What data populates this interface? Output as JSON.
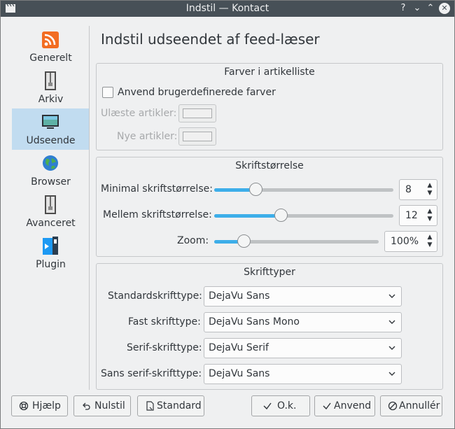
{
  "window": {
    "title": "Indstil — Kontact",
    "help_glyph": "?",
    "minimize_glyph": "⌄",
    "maximize_glyph": "⌃",
    "close_glyph": "✕"
  },
  "sidebar": {
    "items": [
      {
        "label": "Generelt",
        "icon": "rss-icon"
      },
      {
        "label": "Arkiv",
        "icon": "archive-icon"
      },
      {
        "label": "Udseende",
        "icon": "monitor-icon",
        "selected": true
      },
      {
        "label": "Browser",
        "icon": "globe-icon"
      },
      {
        "label": "Avanceret",
        "icon": "archive-icon"
      },
      {
        "label": "Plugin",
        "icon": "plugin-icon"
      }
    ]
  },
  "page": {
    "title": "Indstil udseendet af feed-læser"
  },
  "colors_group": {
    "title": "Farver i artikelliste",
    "custom_colors_label": "Anvend brugerdefinerede farver",
    "custom_colors_checked": false,
    "unread_label": "Ulæste artikler:",
    "new_label": "Nye artikler:"
  },
  "fontsize_group": {
    "title": "Skriftstørrelse",
    "min_label": "Minimal skriftstørrelse:",
    "min_value": "8",
    "min_slider_fraction": 0.23,
    "medium_label": "Mellem skriftstørrelse:",
    "medium_value": "12",
    "medium_slider_fraction": 0.37,
    "zoom_label": "Zoom:",
    "zoom_value": "100%",
    "zoom_slider_fraction": 0.18
  },
  "fonts_group": {
    "title": "Skrifttyper",
    "standard_label": "Standardskrifttype:",
    "standard_value": "DejaVu Sans",
    "fixed_label": "Fast skrifttype:",
    "fixed_value": "DejaVu Sans Mono",
    "serif_label": "Serif-skrifttype:",
    "serif_value": "DejaVu Serif",
    "sans_label": "Sans serif-skrifttype:",
    "sans_value": "DejaVu Sans"
  },
  "buttons": {
    "help": "Hjælp",
    "reset": "Nulstil",
    "defaults": "Standard",
    "ok": "O.k.",
    "apply": "Anvend",
    "cancel": "Annullér"
  },
  "colors": {
    "accent": "#3daee9",
    "selection": "#c1dcf0",
    "titlebar": "#475057"
  }
}
